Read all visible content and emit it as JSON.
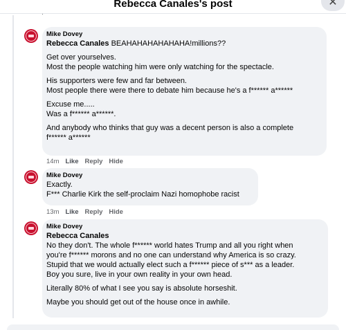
{
  "header": {
    "title": "Rebecca Canales's post",
    "close_label": "✕"
  },
  "comments": [
    {
      "author": "Mike Dovey",
      "reply_to": "Rebecca Canales",
      "first_text": "BEAHAHAHAHAHAHA!millions??",
      "paragraphs": [
        [
          "Get over yourselves.",
          "Most the people watching him were only watching for the spectacle."
        ],
        [
          "His supporters were few and far between.",
          "Most people there were there to debate him because he's a f****** a******"
        ],
        [
          "Excuse me.....",
          "Was a f****** a******."
        ],
        [
          "And anybody who thinks that guy was a decent person is also a complete",
          "f****** a******"
        ]
      ],
      "time": "14m",
      "like": "Like",
      "reply": "Reply",
      "hide": "Hide"
    },
    {
      "author": "Mike Dovey",
      "paragraphs": [
        [
          "Exactly.",
          "F*** Charlie Kirk the self-proclaim Nazi homophobe racist"
        ]
      ],
      "time": "13m",
      "like": "Like",
      "reply": "Reply",
      "hide": "Hide"
    },
    {
      "author": "Mike Dovey",
      "reply_to": "Rebecca Canales",
      "paragraphs": [
        [
          "No they don't. The whole f****** world hates Trump and all you right when",
          "you're f****** morons and no one can understand why America is so crazy.",
          "Stupid that we would actually elect such a f****** piece of s*** as a leader.",
          "Boy you sure, live in your own reality in your own head."
        ],
        [
          "Literally 80% of what I see you say is absolute horseshit."
        ],
        [
          "Maybe you should get out of the house once in awhile."
        ]
      ]
    }
  ],
  "colors": {
    "bubble": "#f0f2f5",
    "meta": "#65676b",
    "avatar": "#c8102e"
  }
}
